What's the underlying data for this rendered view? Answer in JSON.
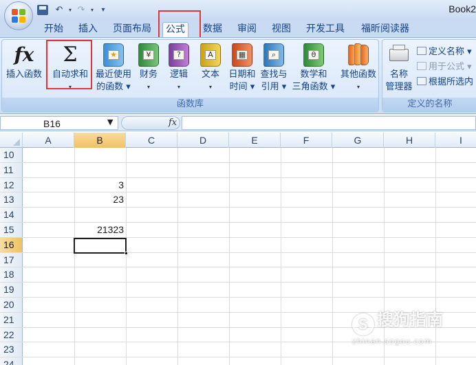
{
  "window": {
    "title": "Book2"
  },
  "quick_access": {
    "save": "save-icon",
    "undo": "↶",
    "redo": "↷",
    "more": "▾"
  },
  "tabs": [
    {
      "label": "开始"
    },
    {
      "label": "插入"
    },
    {
      "label": "页面布局"
    },
    {
      "label": "公式",
      "active": true
    },
    {
      "label": "数据"
    },
    {
      "label": "审阅"
    },
    {
      "label": "视图"
    },
    {
      "label": "开发工具"
    },
    {
      "label": "福昕阅读器"
    }
  ],
  "ribbon": {
    "function_library": {
      "label": "函数库",
      "buttons": [
        {
          "line1": "插入函数",
          "line2": "",
          "icon": "fx-icon",
          "glyph": "fx"
        },
        {
          "line1": "自动求和",
          "line2": "▾",
          "icon": "sigma-icon",
          "glyph": "Σ"
        },
        {
          "line1": "最近使用",
          "line2": "的函数 ▾",
          "icon": "book-star-icon",
          "glyph": "★"
        },
        {
          "line1": "财务",
          "line2": "▾",
          "icon": "book-finance-icon",
          "glyph": "¥"
        },
        {
          "line1": "逻辑",
          "line2": "▾",
          "icon": "book-logic-icon",
          "glyph": "?"
        },
        {
          "line1": "文本",
          "line2": "▾",
          "icon": "book-text-icon",
          "glyph": "A"
        },
        {
          "line1": "日期和",
          "line2": "时间 ▾",
          "icon": "book-date-icon",
          "glyph": "▦"
        },
        {
          "line1": "查找与",
          "line2": "引用 ▾",
          "icon": "book-lookup-icon",
          "glyph": "⌕"
        },
        {
          "line1": "数学和",
          "line2": "三角函数 ▾",
          "icon": "book-math-icon",
          "glyph": "θ"
        },
        {
          "line1": "其他函数",
          "line2": "▾",
          "icon": "book-more-icon",
          "glyph": ""
        }
      ]
    },
    "defined_names": {
      "label": "定义的名称",
      "name_manager_line1": "名称",
      "name_manager_line2": "管理器",
      "define_name": "定义名称 ▾",
      "use_in_formula": "用于公式 ▾",
      "create_from_selection": "根据所选内"
    }
  },
  "formula_bar": {
    "name_box": "B16",
    "fx": "fx",
    "value": ""
  },
  "grid": {
    "columns": [
      "A",
      "B",
      "C",
      "D",
      "E",
      "F",
      "G",
      "H",
      "I"
    ],
    "selected_column": "B",
    "rows": [
      {
        "num": "10",
        "b": ""
      },
      {
        "num": "11",
        "b": ""
      },
      {
        "num": "12",
        "b": "3"
      },
      {
        "num": "13",
        "b": "23"
      },
      {
        "num": "14",
        "b": ""
      },
      {
        "num": "15",
        "b": "21323"
      },
      {
        "num": "16",
        "b": "",
        "selected": true
      },
      {
        "num": "17",
        "b": ""
      },
      {
        "num": "18",
        "b": ""
      },
      {
        "num": "19",
        "b": ""
      },
      {
        "num": "20",
        "b": ""
      },
      {
        "num": "21",
        "b": ""
      },
      {
        "num": "22",
        "b": ""
      },
      {
        "num": "23",
        "b": ""
      },
      {
        "num": "24",
        "b": ""
      }
    ],
    "active_cell": "B16"
  },
  "watermark": {
    "text": "搜狗指南",
    "url": "zhinan.sogou.com"
  },
  "colors": {
    "highlight": "#e03535",
    "selected_header": "#f1c15f"
  }
}
